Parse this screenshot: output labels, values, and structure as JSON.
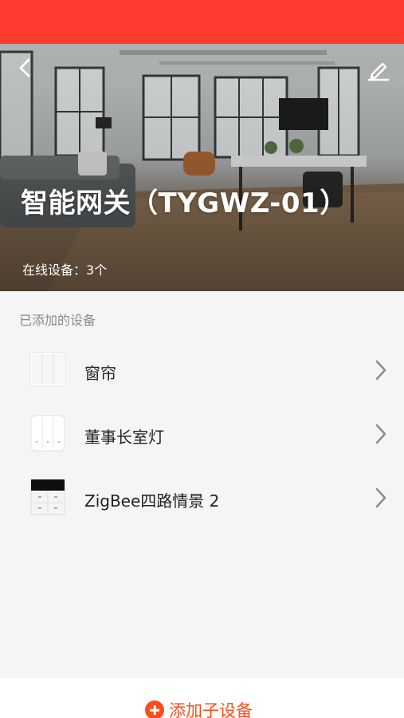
{
  "header": {
    "title": "智能网关（TYGWZ-01）",
    "online_label": "在线设备：",
    "online_count": "3个"
  },
  "section": {
    "label": "已添加的设备"
  },
  "devices": [
    {
      "name": "窗帘",
      "icon": "curtain-switch-icon"
    },
    {
      "name": "董事长室灯",
      "icon": "light-switch-icon"
    },
    {
      "name": "ZigBee四路情景 2",
      "icon": "scene-switch-icon"
    }
  ],
  "footer": {
    "add_label": "添加子设备"
  },
  "colors": {
    "status_bar": "#ff3b30",
    "accent": "#ff4d1a",
    "background": "#f5f5f5"
  }
}
